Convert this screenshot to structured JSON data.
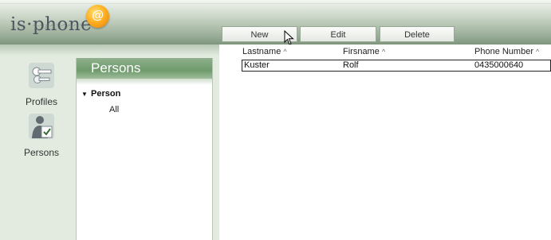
{
  "app": {
    "logo_text": "is·phone",
    "logo_at": "@"
  },
  "toolbar": {
    "new_label": "New",
    "edit_label": "Edit",
    "delete_label": "Delete"
  },
  "nav": {
    "items": [
      {
        "label": "Profiles",
        "icon": "keys-icon"
      },
      {
        "label": "Persons",
        "icon": "person-check-icon"
      }
    ]
  },
  "persons_panel": {
    "title": "Persons",
    "tree": {
      "root_label": "Person",
      "children": [
        "All"
      ]
    }
  },
  "table": {
    "columns": [
      "Lastname",
      "Firsname",
      "Phone Number"
    ],
    "rows": [
      {
        "lastname": "Kuster",
        "firstname": "Rolf",
        "phone": "0435000640"
      }
    ]
  },
  "colors": {
    "header_green": "#7e957c",
    "panel_header": "#6e9a6b",
    "logo_orange": "#ffb223"
  }
}
